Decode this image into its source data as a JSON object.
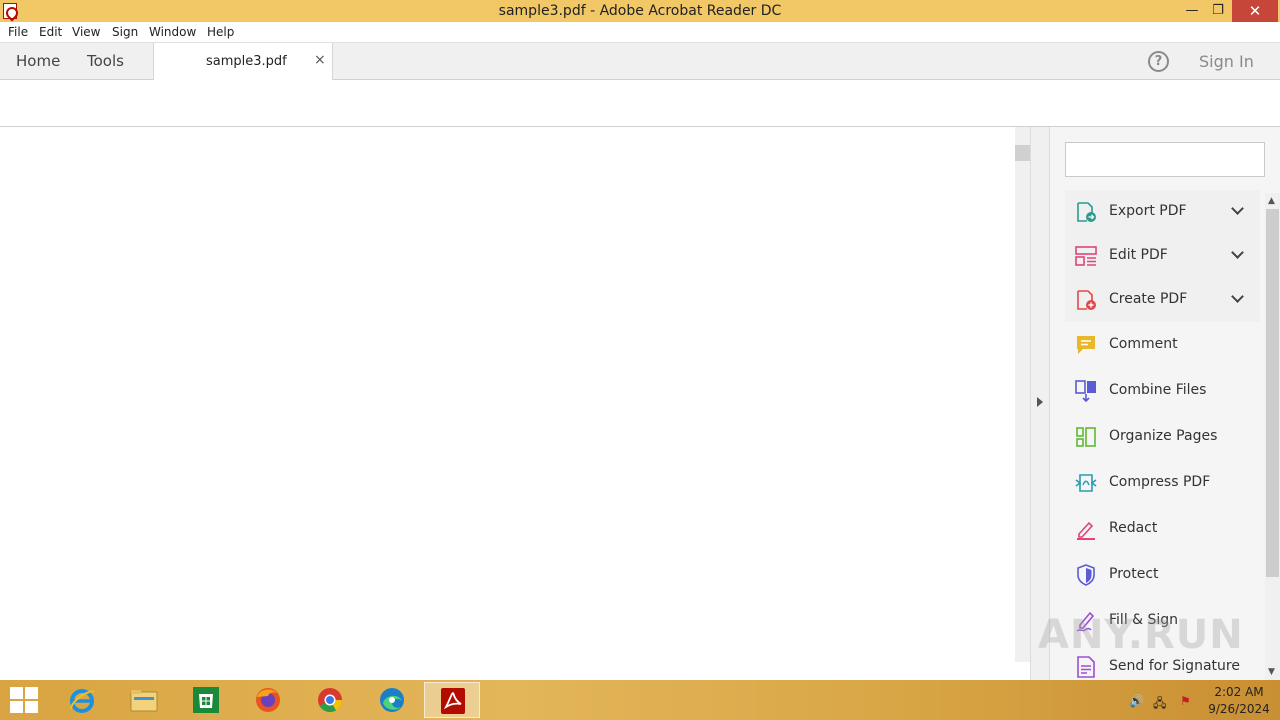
{
  "window": {
    "title": "sample3.pdf - Adobe Acrobat Reader DC",
    "minimize": "—",
    "maximize": "❐",
    "close": "✕"
  },
  "menu": [
    "File",
    "Edit",
    "View",
    "Sign",
    "Window",
    "Help"
  ],
  "tabs": {
    "home": "Home",
    "tools": "Tools",
    "document": "sample3.pdf",
    "close_glyph": "×",
    "help_glyph": "?",
    "sign_in": "Sign In"
  },
  "tools_pane": {
    "search_placeholder": "",
    "items": [
      {
        "label": "Export PDF",
        "icon": "export-pdf-icon",
        "color": "#2d9a8d",
        "expandable": true
      },
      {
        "label": "Edit PDF",
        "icon": "edit-pdf-icon",
        "color": "#e0457b",
        "expandable": true
      },
      {
        "label": "Create PDF",
        "icon": "create-pdf-icon",
        "color": "#e04a4a",
        "expandable": true
      },
      {
        "label": "Comment",
        "icon": "comment-icon",
        "color": "#e8b82a",
        "expandable": false
      },
      {
        "label": "Combine Files",
        "icon": "combine-files-icon",
        "color": "#5b5bd6",
        "expandable": false
      },
      {
        "label": "Organize Pages",
        "icon": "organize-pages-icon",
        "color": "#5fb832",
        "expandable": false
      },
      {
        "label": "Compress PDF",
        "icon": "compress-pdf-icon",
        "color": "#2a9bb0",
        "expandable": false
      },
      {
        "label": "Redact",
        "icon": "redact-icon",
        "color": "#e0457b",
        "expandable": false
      },
      {
        "label": "Protect",
        "icon": "protect-icon",
        "color": "#5b5bd6",
        "expandable": false
      },
      {
        "label": "Fill & Sign",
        "icon": "fill-sign-icon",
        "color": "#9b4fd6",
        "expandable": false
      },
      {
        "label": "Send for Signature",
        "icon": "send-signature-icon",
        "color": "#9b4fd6",
        "expandable": false
      }
    ]
  },
  "watermark": "ANY.RUN",
  "taskbar": {
    "apps": [
      {
        "name": "internet-explorer",
        "icon": "ie-icon"
      },
      {
        "name": "file-explorer",
        "icon": "folder-icon"
      },
      {
        "name": "store",
        "icon": "store-icon"
      },
      {
        "name": "firefox",
        "icon": "firefox-icon"
      },
      {
        "name": "chrome",
        "icon": "chrome-icon"
      },
      {
        "name": "edge",
        "icon": "edge-icon"
      },
      {
        "name": "acrobat-reader",
        "icon": "acrobat-icon",
        "active": true
      }
    ],
    "time": "2:02 AM",
    "date": "9/26/2024"
  }
}
